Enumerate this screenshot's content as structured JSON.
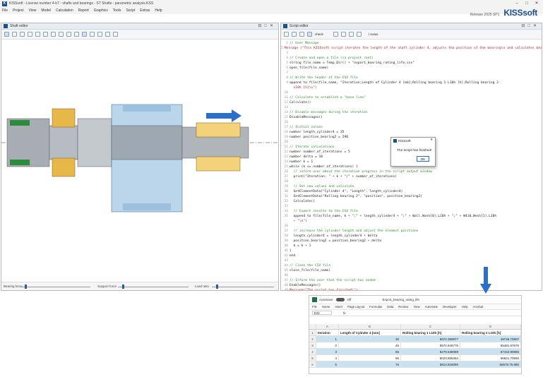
{
  "app": {
    "title": "KISSsoft - License number 4-b7 - shafts and bearings - ST Shafts - parametric analysis.KSS",
    "release": "Release 2025 SP1",
    "brand": "KISSsoft",
    "logo_letter": "K",
    "window_controls": [
      "–",
      "□",
      "✕"
    ]
  },
  "menu": [
    "File",
    "Project",
    "View",
    "Model",
    "Calculation",
    "Report",
    "Graphics",
    "Tools",
    "Script",
    "Extras",
    "Help"
  ],
  "shaft_editor": {
    "title": "Shaft editor",
    "sliders": [
      "Bearing force",
      "Support force",
      "Load ratio"
    ]
  },
  "script_editor": {
    "title": "Script editor",
    "toolbar_field": "check",
    "search_placeholder": "/ Autos",
    "lines": [
      {
        "n": "1",
        "text": "// User Message",
        "type": "comment"
      },
      {
        "n": "2",
        "text": "Message (\"This KISSsoft script iterates the length of the shaft cylinder 4, adjusts the position of the bearing\\n and calculates bearing rating lives. The results are exported into a CSV file.\")",
        "type": "string"
      },
      {
        "n": "3",
        "text": "",
        "type": "code"
      },
      {
        "n": "4",
        "text": "// Create and open a file (in project root)",
        "type": "comment"
      },
      {
        "n": "5",
        "text": "string file_name = Temp_Dir() + \"export_bearing_rating_life.csv\"",
        "type": "code"
      },
      {
        "n": "6",
        "text": "open_file(file_name)",
        "type": "code"
      },
      {
        "n": "7",
        "text": "",
        "type": "code"
      },
      {
        "n": "8",
        "text": "// Write the header of the CSV file",
        "type": "comment"
      },
      {
        "n": "9",
        "text": "append to file(file_name, \"Iteration;Length of Cylinder 4 [mm];Rolling bearing 1 L10h [h];Rolling bearing 2",
        "type": "code"
      },
      {
        "n": "",
        "text": "  L10h [h]\\n\")",
        "type": "string"
      },
      {
        "n": "10",
        "text": "",
        "type": "code"
      },
      {
        "n": "11",
        "text": "// Calculate to establish a \"base line\"",
        "type": "comment"
      },
      {
        "n": "12",
        "text": "Calculate()",
        "type": "code"
      },
      {
        "n": "13",
        "text": "",
        "type": "code"
      },
      {
        "n": "14",
        "text": "// Disable messages during the iteration",
        "type": "comment"
      },
      {
        "n": "15",
        "text": "DisableMessages()",
        "type": "code"
      },
      {
        "n": "16",
        "text": "",
        "type": "code"
      },
      {
        "n": "17",
        "text": "// Initial values",
        "type": "comment"
      },
      {
        "n": "18",
        "text": "number length_cylinder4 = 35",
        "type": "code"
      },
      {
        "n": "19",
        "text": "number position_bearing2 = 290",
        "type": "code"
      },
      {
        "n": "20",
        "text": "",
        "type": "code"
      },
      {
        "n": "21",
        "text": "// Iterate calculations",
        "type": "comment"
      },
      {
        "n": "22",
        "text": "number number_of_iterations = 5",
        "type": "code"
      },
      {
        "n": "23",
        "text": "number delta = 10",
        "type": "code"
      },
      {
        "n": "24",
        "text": "number k = 1",
        "type": "code"
      },
      {
        "n": "25",
        "text": "while (k <= number_of_iterations) {",
        "type": "code"
      },
      {
        "n": "26",
        "text": "  // inform user about the iteration progress in the script output window",
        "type": "comment"
      },
      {
        "n": "27",
        "text": "  print(\"Iteration: \" + k + \"/\" + number_of_iterations)",
        "type": "code"
      },
      {
        "n": "28",
        "text": "",
        "type": "code"
      },
      {
        "n": "29",
        "text": "  // Set new values and calculate",
        "type": "comment"
      },
      {
        "n": "30",
        "text": "  SetElementData(\"Cylinder 4\", \"Length\", length_cylinder4)",
        "type": "code"
      },
      {
        "n": "31",
        "text": "  SetElementData(\"Rolling bearing 2\", \"position\", position_bearing2)",
        "type": "code"
      },
      {
        "n": "32",
        "text": "  Calculate()",
        "type": "code"
      },
      {
        "n": "33",
        "text": "",
        "type": "code"
      },
      {
        "n": "34",
        "text": "  // Export results to the CSV file",
        "type": "comment"
      },
      {
        "n": "35",
        "text": "  append to file(file_name, k + \";\" + length_cylinder4 + \";\" + Wall.Wash[0].L10h + \";\" + W410.Wesh[1].L10h",
        "type": "code"
      },
      {
        "n": "",
        "text": "  + \"\\n\")",
        "type": "string"
      },
      {
        "n": "36",
        "text": "",
        "type": "code"
      },
      {
        "n": "37",
        "text": "  // increase the cylinder length and adjust the element positions",
        "type": "comment"
      },
      {
        "n": "38",
        "text": "  length_cylinder4 = length_cylinder4 + delta",
        "type": "code"
      },
      {
        "n": "39",
        "text": "  position_bearing2 = position_bearing2 + delta",
        "type": "code"
      },
      {
        "n": "40",
        "text": "  k = k + 1",
        "type": "code"
      },
      {
        "n": "41",
        "text": "}",
        "type": "code"
      },
      {
        "n": "42",
        "text": "end",
        "type": "code"
      },
      {
        "n": "43",
        "text": "",
        "type": "code"
      },
      {
        "n": "44",
        "text": "// Close the CSV file",
        "type": "comment"
      },
      {
        "n": "45",
        "text": "close_file(file_name)",
        "type": "code"
      },
      {
        "n": "46",
        "text": "",
        "type": "code"
      },
      {
        "n": "47",
        "text": "// Inform the user that the script has ended",
        "type": "comment"
      },
      {
        "n": "48",
        "text": "EnableMessages()",
        "type": "code"
      },
      {
        "n": "49",
        "text": "Message(\"The script has finished!\")",
        "type": "string"
      }
    ]
  },
  "dialog": {
    "title": "KISSsoft",
    "message": "The script has finished!",
    "ok": "OK",
    "close": "✕"
  },
  "excel": {
    "autosave": "AutoSave",
    "toggle": "Off",
    "filename": "Export_bearing_rating_life",
    "ribbon": [
      "File",
      "Home",
      "Insert",
      "Page Layout",
      "Formulas",
      "Data",
      "Review",
      "View",
      "Automate",
      "Developer",
      "Help",
      "Acrobat"
    ],
    "cell_ref": "E22",
    "fx": "fx",
    "columns": [
      "A",
      "B",
      "C",
      "D"
    ],
    "headers": [
      "Iteration",
      "Length of Cylinder 4 [mm]",
      "Rolling bearing 1 L10h [h]",
      "Rolling bearing 2 L10h [h]"
    ],
    "rows": [
      {
        "r": "2",
        "cells": [
          "1",
          "35",
          "8872.399877",
          "49745.70807"
        ]
      },
      {
        "r": "3",
        "cells": [
          "2",
          "45",
          "8572.846776",
          "65481.67676"
        ]
      },
      {
        "r": "4",
        "cells": [
          "3",
          "55",
          "8279.538089",
          "67162.90986"
        ]
      },
      {
        "r": "5",
        "cells": [
          "4",
          "65",
          "8023.806364",
          "66621.70550"
        ]
      },
      {
        "r": "6",
        "cells": [
          "5",
          "75",
          "5814.818090",
          "55578.75.880"
        ]
      }
    ]
  },
  "colors": {
    "brand_blue": "#1a4f8a",
    "arrow_blue": "#2a6fc9",
    "bearing_gold": "#e6b84a",
    "shaft_grey": "#a8adb3",
    "hub_blue": "#b8d4ea",
    "seal_green": "#2e8b3e",
    "excel_band": "#c9e2f1"
  }
}
